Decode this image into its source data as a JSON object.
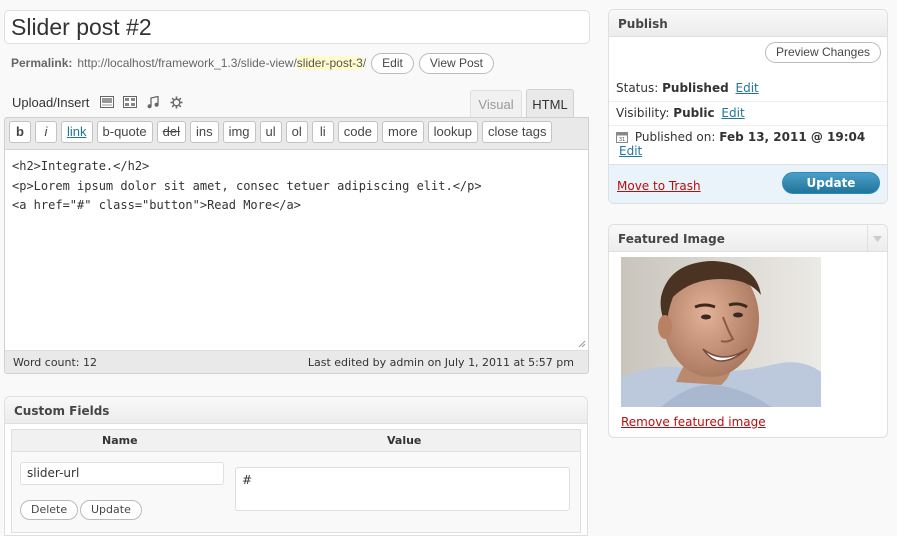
{
  "post": {
    "title": "Slider post #2",
    "permalink_label": "Permalink:",
    "permalink_base": "http://localhost/framework_1.3/slide-view/",
    "permalink_slug": "slider-post-3",
    "permalink_trailing": "/",
    "edit_button": "Edit",
    "view_post_button": "View Post"
  },
  "editor": {
    "upload_label": "Upload/Insert",
    "media_icons": [
      "image-icon",
      "video-icon",
      "audio-icon",
      "media-icon"
    ],
    "tab_visual": "Visual",
    "tab_html": "HTML",
    "quicktags": [
      "b",
      "i",
      "link",
      "b-quote",
      "del",
      "ins",
      "img",
      "ul",
      "ol",
      "li",
      "code",
      "more",
      "lookup",
      "close tags"
    ],
    "content_lines": [
      "<h2>Integrate.</h2>",
      "<p>Lorem ipsum dolor sit amet, consec tetuer adipiscing elit.</p>",
      "<a href=\"#\" class=\"button\">Read More</a>"
    ],
    "word_count": "Word count: 12",
    "last_edited": "Last edited by admin on July 1, 2011 at 5:57 pm"
  },
  "custom_fields": {
    "title": "Custom Fields",
    "col_name": "Name",
    "col_value": "Value",
    "key": "slider-url",
    "value": "#",
    "delete_button": "Delete",
    "update_button": "Update"
  },
  "publish": {
    "title": "Publish",
    "preview_button": "Preview Changes",
    "status_label": "Status:",
    "status_value": "Published",
    "visibility_label": "Visibility:",
    "visibility_value": "Public",
    "published_label": "Published on:",
    "published_value": "Feb 13, 2011 @ 19:04",
    "edit_link": "Edit",
    "trash_link": "Move to Trash",
    "update_button": "Update"
  },
  "featured": {
    "title": "Featured Image",
    "remove_link": "Remove featured image"
  },
  "colors": {
    "link": "#21759b",
    "danger": "#bc0b0b",
    "primary": "#21759b",
    "slug_highlight": "#fffbcc"
  }
}
